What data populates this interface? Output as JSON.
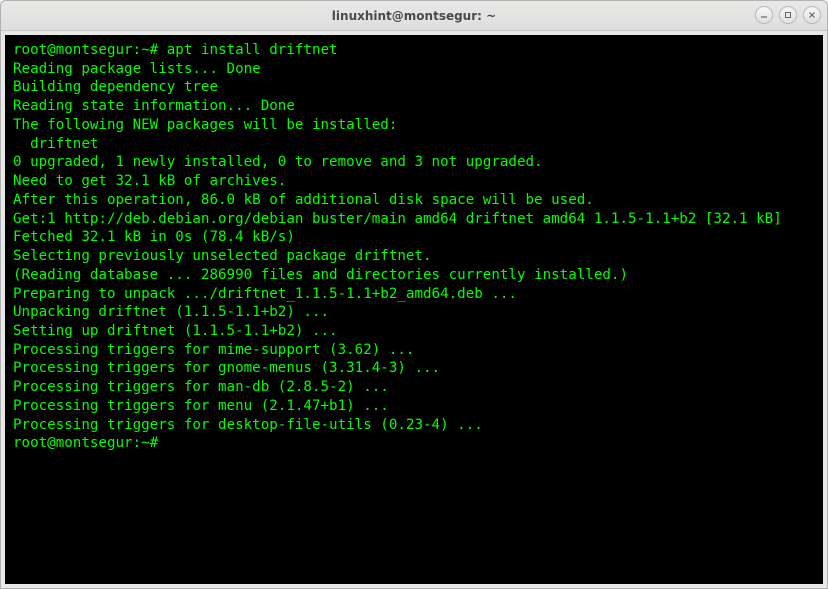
{
  "window": {
    "title": "linuxhint@montsegur: ~"
  },
  "terminal": {
    "prompt1": "root@montsegur:~# ",
    "command1": "apt install driftnet",
    "lines": [
      "Reading package lists... Done",
      "Building dependency tree",
      "Reading state information... Done",
      "The following NEW packages will be installed:",
      "  driftnet",
      "0 upgraded, 1 newly installed, 0 to remove and 3 not upgraded.",
      "Need to get 32.1 kB of archives.",
      "After this operation, 86.0 kB of additional disk space will be used.",
      "Get:1 http://deb.debian.org/debian buster/main amd64 driftnet amd64 1.1.5-1.1+b2 [32.1 kB]",
      "Fetched 32.1 kB in 0s (78.4 kB/s)",
      "Selecting previously unselected package driftnet.",
      "(Reading database ... 286990 files and directories currently installed.)",
      "Preparing to unpack .../driftnet_1.1.5-1.1+b2_amd64.deb ...",
      "Unpacking driftnet (1.1.5-1.1+b2) ...",
      "Setting up driftnet (1.1.5-1.1+b2) ...",
      "Processing triggers for mime-support (3.62) ...",
      "Processing triggers for gnome-menus (3.31.4-3) ...",
      "Processing triggers for man-db (2.8.5-2) ...",
      "Processing triggers for menu (2.1.47+b1) ...",
      "Processing triggers for desktop-file-utils (0.23-4) ..."
    ],
    "prompt2": "root@montsegur:~# "
  }
}
